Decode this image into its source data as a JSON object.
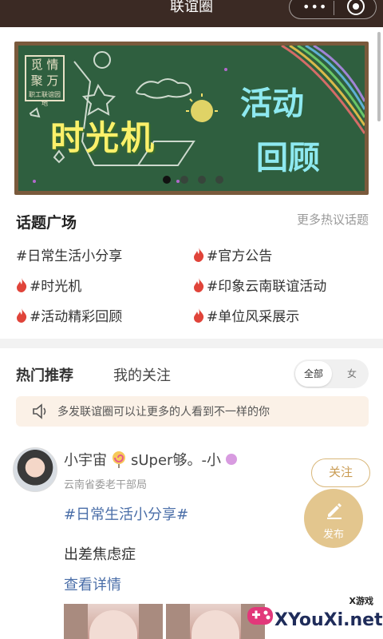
{
  "topbar": {
    "title": "联谊圈",
    "menu_icon": "more-dots-icon",
    "close_icon": "target-icon"
  },
  "banner": {
    "logo_top": "觅 情",
    "logo_mid": "聚 万",
    "logo_bottom": "职工联谊园地",
    "title": "时光机",
    "subtitle_line1": "活动",
    "subtitle_line2": "回顾",
    "page_count": 4,
    "active_page": 1
  },
  "topics": {
    "title": "话题广场",
    "more": "更多热议话题",
    "items": [
      {
        "label": "#日常生活小分享",
        "hot": false
      },
      {
        "label": "#官方公告",
        "hot": true
      },
      {
        "label": "#时光机",
        "hot": true
      },
      {
        "label": "#印象云南联谊活动",
        "hot": true
      },
      {
        "label": "#活动精彩回顾",
        "hot": true
      },
      {
        "label": "#单位风采展示",
        "hot": true
      }
    ]
  },
  "tabs": {
    "hot": "热门推荐",
    "follow": "我的关注",
    "filter_all": "全部",
    "filter_female": "女"
  },
  "notice": {
    "text": "多发联谊圈可以让更多的人看到不一样的你"
  },
  "post": {
    "username_a": "小宇宙",
    "username_b": "sUper够。-小",
    "org": "云南省委老干部局",
    "follow": "关注",
    "tag": "#日常生活小分享#",
    "text": "出差焦虑症",
    "more": "查看详情"
  },
  "publish": {
    "label": "发布"
  },
  "watermark": {
    "small": "X游戏",
    "big": "XYouXi.net"
  },
  "colors": {
    "topbar": "#3b2a24",
    "accent_gold": "#e2c389",
    "link_blue": "#4a6ea8",
    "flame_red": "#e0443a"
  }
}
